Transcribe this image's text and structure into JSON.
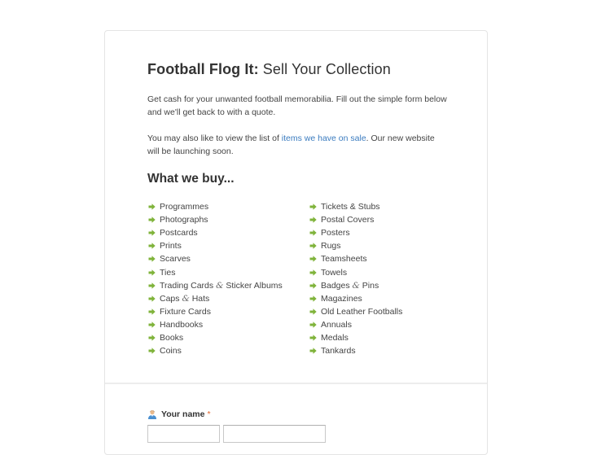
{
  "header": {
    "brand": "Football Flog It:",
    "title": "Sell Your Collection"
  },
  "intro": {
    "paragraph1": "Get cash for your unwanted football memorabilia. Fill out the simple form below and we'll get back to with a quote.",
    "paragraph2_before": "You may also like to view the list of ",
    "paragraph2_link": "items we have on sale",
    "paragraph2_after": ". Our new website will be launching soon."
  },
  "what_we_buy": {
    "heading": "What we buy...",
    "left_column": [
      {
        "text": "Programmes"
      },
      {
        "text": "Photographs"
      },
      {
        "text": "Postcards"
      },
      {
        "text": "Prints"
      },
      {
        "text": "Scarves"
      },
      {
        "text": "Ties"
      },
      {
        "pre": "Trading Cards ",
        "amp": "&",
        "post": " Sticker Albums"
      },
      {
        "pre": "Caps ",
        "amp": "&",
        "post": " Hats"
      },
      {
        "text": "Fixture Cards"
      },
      {
        "text": "Handbooks"
      },
      {
        "text": "Books"
      },
      {
        "text": "Coins"
      }
    ],
    "right_column": [
      {
        "text": "Tickets & Stubs"
      },
      {
        "text": "Postal Covers"
      },
      {
        "text": "Posters"
      },
      {
        "text": "Rugs"
      },
      {
        "text": "Teamsheets"
      },
      {
        "text": "Towels"
      },
      {
        "pre": "Badges ",
        "amp": "&",
        "post": " Pins"
      },
      {
        "text": "Magazines"
      },
      {
        "text": "Old Leather Footballs"
      },
      {
        "text": "Annuals"
      },
      {
        "text": "Medals"
      },
      {
        "text": "Tankards"
      }
    ],
    "bullet_icon": "green-arrow-icon",
    "bullet_color": "#7fb33a"
  },
  "form": {
    "name_label": "Your name",
    "required_marker": "*",
    "label_icon": "person-icon",
    "first_name_value": "",
    "last_name_value": ""
  },
  "colors": {
    "link": "#3a7bbf",
    "required": "#e0652c",
    "border": "#e4e4e4"
  }
}
